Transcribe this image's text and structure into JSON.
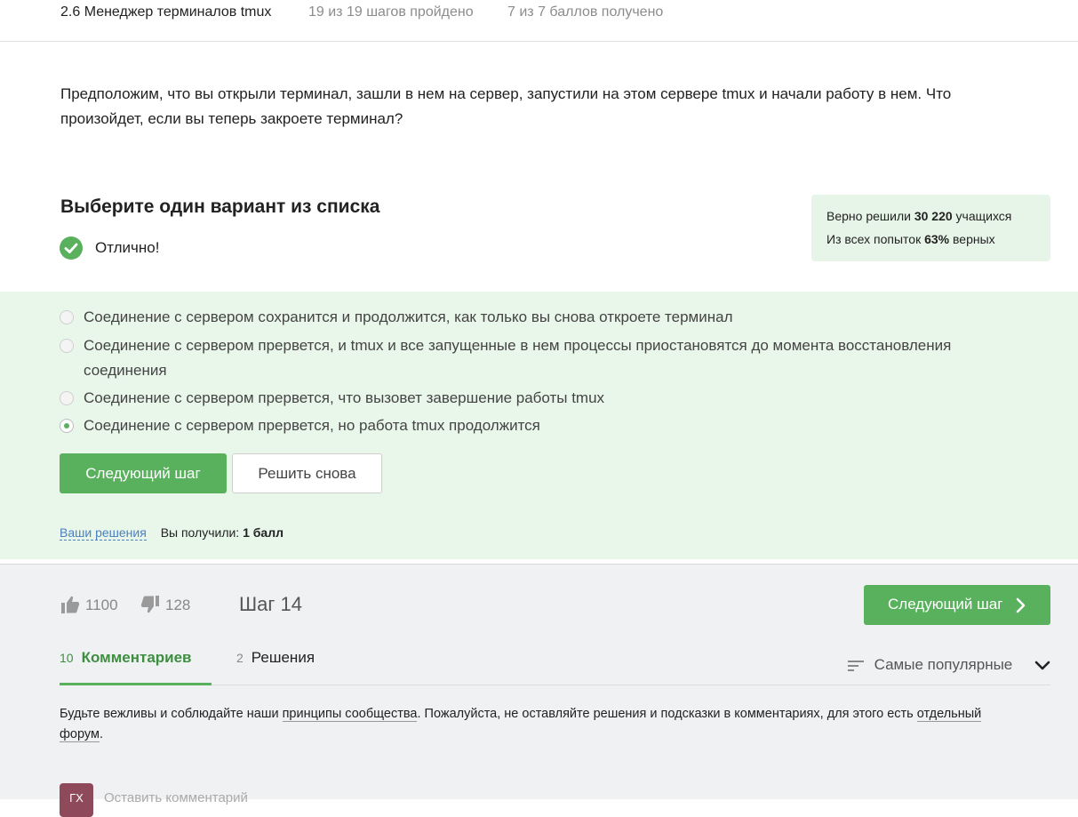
{
  "header": {
    "lesson_title": "2.6 Менеджер терминалов tmux",
    "steps_progress": "19 из 19 шагов пройдено",
    "points_progress": "7 из 7 баллов  получено"
  },
  "question": {
    "text": "Предположим, что вы открыли терминал, зашли в нем на сервер, запустили на этом сервере tmux и начали работу в нем. Что произойдет, если вы теперь закроете терминал?"
  },
  "quiz": {
    "title": "Выберите один вариант из списка",
    "result_label": "Отлично!",
    "stats": {
      "solved_prefix": "Верно решили ",
      "solved_count": "30 220",
      "solved_suffix": " учащихся",
      "attempts_prefix": "Из всех попыток ",
      "attempts_percent": "63%",
      "attempts_suffix": " верных"
    },
    "options": [
      {
        "text": "Соединение с сервером сохранится и продолжится, как только вы снова откроете терминал",
        "selected": false
      },
      {
        "text": "Соединение с сервером прервется, и tmux и все запущенные в нем процессы приостановятся до момента восстановления соединения",
        "selected": false
      },
      {
        "text": "Соединение с сервером прервется, что вызовет завершение работы tmux",
        "selected": false
      },
      {
        "text": "Соединение с сервером прервется, но работа tmux продолжится",
        "selected": true
      }
    ],
    "next_step_label": "Следующий шаг",
    "retry_label": "Решить снова",
    "your_solutions_label": "Ваши решения",
    "score_prefix": "Вы получили: ",
    "score_value": "1 балл"
  },
  "footer": {
    "likes": "1100",
    "dislikes": "128",
    "step_label": "Шаг 14",
    "next_step_label": "Следующий шаг",
    "tabs": [
      {
        "count": "10",
        "label": "Комментариев",
        "active": true
      },
      {
        "count": "2",
        "label": "Решения",
        "active": false
      }
    ],
    "sort_label": "Самые популярные",
    "rules": {
      "part1": "Будьте вежливы и соблюдайте наши ",
      "link1": "принципы сообщества",
      "part2": ". Пожалуйста, не оставляйте решения и подсказки в комментариях, для этого есть ",
      "link2": "отдельный форум",
      "part3": "."
    },
    "avatar_initials": "ГХ",
    "comment_placeholder": "Оставить комментарий"
  },
  "colors": {
    "accent_green": "#59b15d",
    "panel_green": "#e9f6ea",
    "link_blue": "#4a7fc1"
  },
  "icons": [
    "check-circle-icon",
    "thumbs-up-icon",
    "thumbs-down-icon",
    "chevron-right-icon",
    "sort-lines-icon",
    "chevron-down-icon"
  ]
}
